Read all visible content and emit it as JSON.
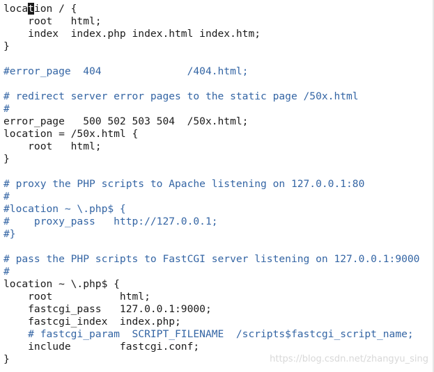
{
  "editor": {
    "lines": [
      {
        "pre": "loca",
        "cursor": "t",
        "post": "ion / {",
        "comment": false
      },
      {
        "text": "    root   html;",
        "comment": false
      },
      {
        "text": "    index  index.php index.html index.htm;",
        "comment": false
      },
      {
        "text": "}",
        "comment": false
      },
      {
        "text": "",
        "comment": false
      },
      {
        "text": "#error_page  404              /404.html;",
        "comment": true
      },
      {
        "text": "",
        "comment": false
      },
      {
        "text": "# redirect server error pages to the static page /50x.html",
        "comment": true
      },
      {
        "text": "#",
        "comment": true
      },
      {
        "text": "error_page   500 502 503 504  /50x.html;",
        "comment": false
      },
      {
        "text": "location = /50x.html {",
        "comment": false
      },
      {
        "text": "    root   html;",
        "comment": false
      },
      {
        "text": "}",
        "comment": false
      },
      {
        "text": "",
        "comment": false
      },
      {
        "text": "# proxy the PHP scripts to Apache listening on 127.0.0.1:80",
        "comment": true
      },
      {
        "text": "#",
        "comment": true
      },
      {
        "text": "#location ~ \\.php$ {",
        "comment": true
      },
      {
        "text": "#    proxy_pass   http://127.0.0.1;",
        "comment": true
      },
      {
        "text": "#}",
        "comment": true
      },
      {
        "text": "",
        "comment": false
      },
      {
        "text": "# pass the PHP scripts to FastCGI server listening on 127.0.0.1:9000",
        "comment": true
      },
      {
        "text": "#",
        "comment": true
      },
      {
        "text": "location ~ \\.php$ {",
        "comment": false
      },
      {
        "text": "    root           html;",
        "comment": false
      },
      {
        "text": "    fastcgi_pass   127.0.0.1:9000;",
        "comment": false
      },
      {
        "text": "    fastcgi_index  index.php;",
        "comment": false
      },
      {
        "text": "    # fastcgi_param  SCRIPT_FILENAME  /scripts$fastcgi_script_name;",
        "comment": true
      },
      {
        "text": "    include        fastcgi.conf;",
        "comment": false
      },
      {
        "text": "}",
        "comment": false
      }
    ]
  },
  "watermark": {
    "text": "https://blog.csdn.net/zhangyu_sing"
  },
  "colors": {
    "text": "#1a1a1a",
    "comment": "#3465a4",
    "background": "#ffffff",
    "cursor": "#1a1a1a"
  }
}
